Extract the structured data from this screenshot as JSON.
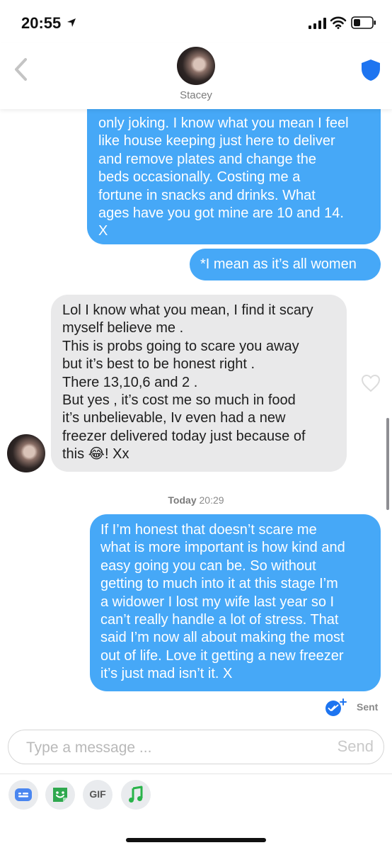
{
  "status_bar": {
    "time": "20:55"
  },
  "header": {
    "contact_name": "Stacey"
  },
  "messages": [
    {
      "direction": "outgoing",
      "lines": [
        "only joking. I know what you mean I feel",
        "like house keeping just here to deliver",
        "and remove plates and change the",
        "beds occasionally. Costing me a",
        "fortune in snacks and drinks. What",
        "ages have you got mine are 10 and 14.",
        "X"
      ]
    },
    {
      "direction": "outgoing",
      "lines": [
        "*I mean as it’s all women"
      ]
    },
    {
      "direction": "incoming",
      "lines": [
        "Lol I know what you mean, I find it scary",
        "myself believe me .",
        "This is probs going to scare you away",
        "but it’s best to be honest right .",
        "There 13,10,6 and 2 .",
        "But yes , it’s cost me so much in food",
        "it’s unbelievable, Iv even had a new",
        "freezer delivered today just because of",
        "this 😂! Xx"
      ]
    },
    {
      "direction": "outgoing",
      "lines": [
        "If I’m honest that doesn’t scare me",
        "what is more important is how kind and",
        "easy going you can be. So without",
        "getting to much into it at this stage I’m",
        "a widower I lost my wife last year so I",
        "can’t really handle a lot of stress. That",
        "said I’m now all about making the most",
        "out of life. Love it getting a new freezer",
        "it’s just mad isn’t it. X"
      ]
    }
  ],
  "timestamp": {
    "day": "Today",
    "time": "20:29"
  },
  "delivery_status": "Sent",
  "composer": {
    "placeholder": "Type a message ...",
    "send_label": "Send"
  },
  "toolbar": {
    "gif_label": "GIF"
  },
  "colors": {
    "outgoing_bubble": "#46a8f7",
    "incoming_bubble": "#e9e9ea",
    "shield_accent": "#1d74f0",
    "sticker_accent": "#2fa84f",
    "music_accent": "#29b34a"
  }
}
